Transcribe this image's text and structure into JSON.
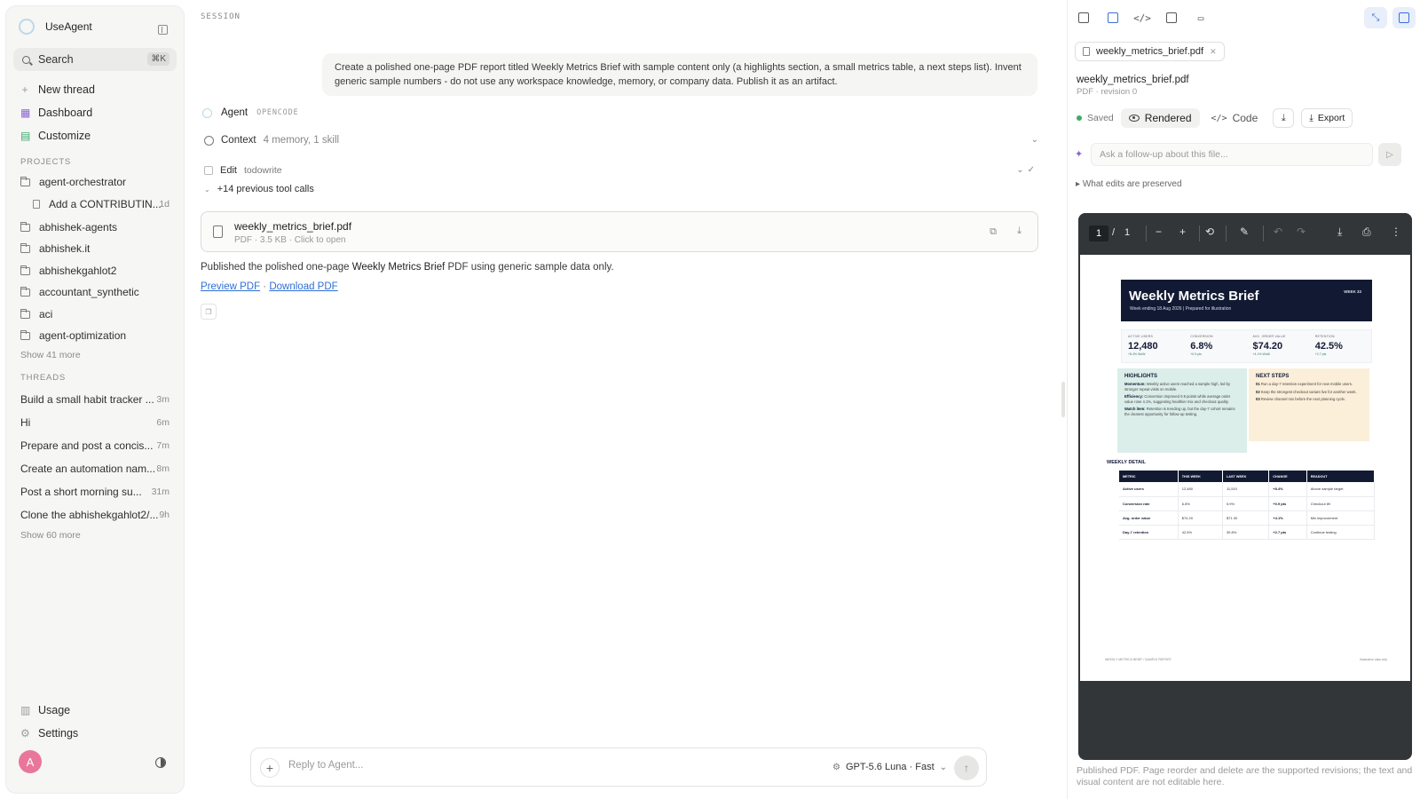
{
  "sidebar": {
    "app_name": "UseAgent",
    "search": {
      "label": "Search",
      "shortcut": "⌘K"
    },
    "nav": [
      {
        "label": "New thread",
        "icon": "plus-icon"
      },
      {
        "label": "Dashboard",
        "icon": "dashboard-icon"
      },
      {
        "label": "Customize",
        "icon": "customize-icon"
      }
    ],
    "projects_label": "PROJECTS",
    "projects": [
      {
        "label": "agent-orchestrator"
      },
      {
        "label": "Add a CONTRIBUTIN...",
        "meta": "1d"
      },
      {
        "label": "abhishek-agents"
      },
      {
        "label": "abhishek.it"
      },
      {
        "label": "abhishekgahlot2"
      },
      {
        "label": "accountant_synthetic"
      },
      {
        "label": "aci"
      },
      {
        "label": "agent-optimization"
      }
    ],
    "projects_more": "Show 41 more",
    "threads_label": "THREADS",
    "threads": [
      {
        "label": "Build a small habit tracker ...",
        "age": "3m"
      },
      {
        "label": "Hi",
        "age": "6m"
      },
      {
        "label": "Prepare and post a concis...",
        "age": "7m"
      },
      {
        "label": "Create an automation nam...",
        "age": "8m"
      },
      {
        "label": "Post a short morning su...",
        "age": "31m"
      },
      {
        "label": "Clone the abhishekgahlot2/...",
        "age": "9h"
      }
    ],
    "threads_more": "Show 60 more",
    "bottom": [
      {
        "label": "Usage",
        "icon": "usage-icon"
      },
      {
        "label": "Settings",
        "icon": "settings-icon"
      }
    ],
    "avatar_initial": "A"
  },
  "session": {
    "label": "SESSION",
    "user_message": "Create a polished one-page PDF report titled Weekly Metrics Brief with sample content only (a highlights section, a small metrics table, a next steps list). Invent generic sample numbers - do not use any workspace knowledge, memory, or company data. Publish it as an artifact.",
    "agent_name": "Agent",
    "agent_engine": "OPENCODE",
    "context_label": "Context",
    "context_meta": "4 memory, 1 skill",
    "edit_label": "Edit",
    "edit_meta": "todowrite",
    "previous_calls": "+14 previous tool calls",
    "file_card": {
      "name": "weekly_metrics_brief.pdf",
      "meta": "PDF · 3.5 KB · Click to open"
    },
    "published_pre": "Published the polished one-page ",
    "published_bold": "Weekly Metrics Brief",
    "published_post": " PDF using generic sample data only.",
    "preview_link": "Preview PDF",
    "link_sep": " · ",
    "download_link": "Download PDF"
  },
  "composer": {
    "placeholder": "Reply to Agent...",
    "model": "GPT-5.6 Luna · Fast"
  },
  "file_panel": {
    "tab_name": "weekly_metrics_brief.pdf",
    "doc_title": "weekly_metrics_brief.pdf",
    "doc_sub": "PDF · revision 0",
    "saved": "Saved",
    "rendered": "Rendered",
    "code": "Code",
    "export": "Export",
    "followup_placeholder": "Ask a follow-up about this file...",
    "preserved": "What edits are preserved",
    "viewer": {
      "page": "1",
      "sep": "/",
      "total": "1"
    },
    "caption": "Published PDF. Page reorder and delete are the supported revisions; the text and visual content are not editable here.",
    "colors": {
      "accent": "#3b6fd9",
      "pdf_navy": "#121a33",
      "highlights_bg": "#dbeee9",
      "next_steps_bg": "#fbefd9",
      "saved_dot": "#3eaa67"
    }
  },
  "pdf": {
    "title": "Weekly Metrics Brief",
    "subtitle": "Week ending 18 Aug 2026 | Prepared for illustration",
    "week_tag": "WEEK 33",
    "metrics": [
      {
        "label": "ACTIVE USERS",
        "value": "12,480",
        "delta": "+8.4% WoW"
      },
      {
        "label": "CONVERSION",
        "value": "6.8%",
        "delta": "+0.9 pts"
      },
      {
        "label": "AVG. ORDER VALUE",
        "value": "$74.20",
        "delta": "+4.1% WoW"
      },
      {
        "label": "RETENTION",
        "value": "42.5%",
        "delta": "+2.7 pts"
      }
    ],
    "highlights_title": "HIGHLIGHTS",
    "highlights": [
      {
        "key": "Momentum:",
        "text": " Weekly active users reached a sample high, led by stronger repeat visits on mobile."
      },
      {
        "key": "Efficiency:",
        "text": " Conversion improved 0.9 points while average order value rose 4.1%, suggesting healthier mix and checkout quality."
      },
      {
        "key": "Watch item:",
        "text": " Retention is trending up, but the day-7 cohort remains the clearest opportunity for follow-up testing."
      }
    ],
    "next_steps_title": "NEXT STEPS",
    "next_steps": [
      {
        "key": "01",
        "text": " Run a day-7 retention experiment for new mobile users."
      },
      {
        "key": "02",
        "text": " Keep the strongest checkout variant live for another week."
      },
      {
        "key": "03",
        "text": " Review channel mix before the next planning cycle."
      }
    ],
    "detail_title": "WEEKLY DETAIL",
    "table_headers": [
      "METRIC",
      "THIS WEEK",
      "LAST WEEK",
      "CHANGE",
      "READOUT"
    ],
    "table_rows": [
      [
        "Active users",
        "12,480",
        "11,510",
        "+8.4%",
        "Above sample target"
      ],
      [
        "Conversion rate",
        "6.8%",
        "5.9%",
        "+0.9 pts",
        "Checkout lift"
      ],
      [
        "Avg. order value",
        "$74.20",
        "$71.30",
        "+4.1%",
        "Mix improvement"
      ],
      [
        "Day-7 retention",
        "42.5%",
        "39.8%",
        "+2.7 pts",
        "Continue testing"
      ]
    ],
    "footer_left": "WEEKLY METRICS BRIEF  /  SAMPLE REPORT",
    "footer_right": "Illustrative data only"
  }
}
